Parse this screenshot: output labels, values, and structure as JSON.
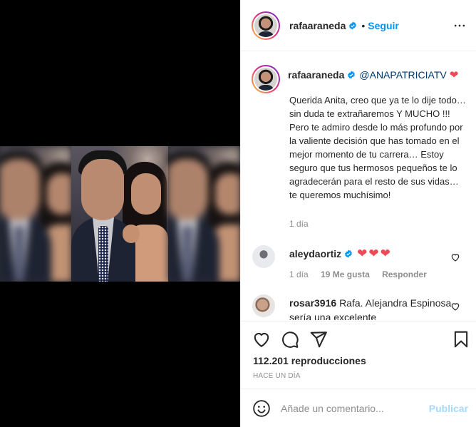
{
  "post": {
    "username": "rafaaraneda",
    "follow_label": "Seguir",
    "separator": "•",
    "caption_mention": "@ANAPATRICIATV",
    "caption_text": "Querida Anita, creo que ya te lo dije todo… sin duda te extrañaremos Y MUCHO !!! Pero te admiro desde lo más profundo por la valiente decisión que has tomado en el mejor momento de tu carrera… Estoy seguro que tus hermosos pequeños te lo agradecerán para el resto de sus vidas… te queremos muchísimo!",
    "caption_time": "1 día"
  },
  "comments": [
    {
      "username": "aleydaortiz",
      "text": "❤❤❤",
      "time": "1 día",
      "likes": "19 Me gusta",
      "reply_label": "Responder"
    },
    {
      "username": "rosar3916",
      "text": "Rafa. Alejandra Espinosa sería una excelente"
    }
  ],
  "stats": {
    "views": "112.201 reproducciones",
    "posted_ago": "HACE UN DÍA"
  },
  "composer": {
    "placeholder": "Añade un comentario...",
    "post_label": "Publicar"
  },
  "colors": {
    "link_blue": "#0095f6",
    "heart_red": "#ed4956",
    "secondary_text": "#8e8e8e"
  },
  "icons": [
    "verified-badge-icon",
    "more-options-icon",
    "heart-icon",
    "comment-icon",
    "share-icon",
    "bookmark-icon",
    "emoji-icon"
  ]
}
